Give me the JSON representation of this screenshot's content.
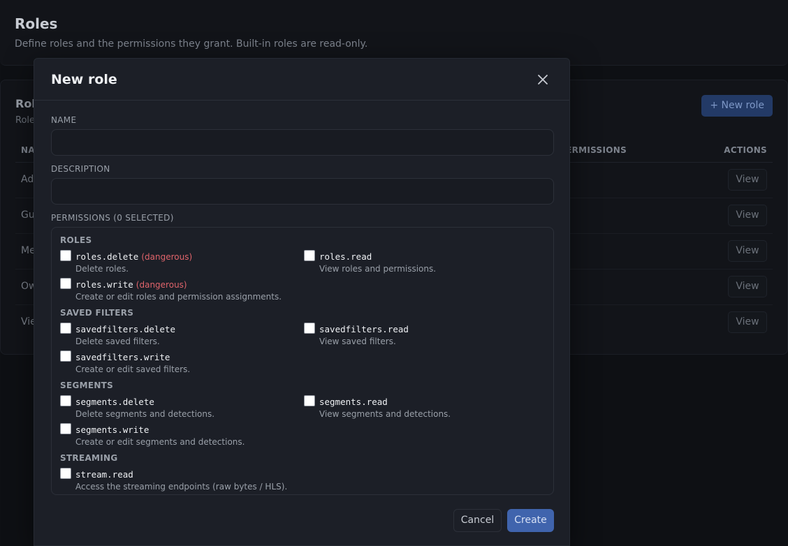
{
  "page": {
    "title": "Roles",
    "subtitle": "Define roles and the permissions they grant. Built-in roles are read-only."
  },
  "roles_card": {
    "title": "Roles",
    "subtitle": "Roles",
    "new_role_label": "+ New role",
    "columns": {
      "name": "NAME",
      "permissions": "PERMISSIONS",
      "actions": "ACTIONS"
    },
    "rows": [
      {
        "name": "Admin",
        "action": "View"
      },
      {
        "name": "Guest",
        "action": "View"
      },
      {
        "name": "Member",
        "action": "View"
      },
      {
        "name": "Owner",
        "action": "View"
      },
      {
        "name": "Viewer",
        "action": "View"
      }
    ]
  },
  "modal": {
    "title": "New role",
    "name_label": "NAME",
    "name_value": "",
    "description_label": "DESCRIPTION",
    "description_value": "",
    "permissions_label": "PERMISSIONS (0 SELECTED)",
    "groups": [
      {
        "title": "ROLES",
        "items": [
          {
            "key": "roles.delete",
            "danger": "(dangerous)",
            "desc": "Delete roles.",
            "checked": false
          },
          {
            "key": "roles.read",
            "danger": "",
            "desc": "View roles and permissions.",
            "checked": false
          },
          {
            "key": "roles.write",
            "danger": "(dangerous)",
            "desc": "Create or edit roles and permission assignments.",
            "checked": false
          }
        ]
      },
      {
        "title": "SAVED FILTERS",
        "items": [
          {
            "key": "savedfilters.delete",
            "danger": "",
            "desc": "Delete saved filters.",
            "checked": false
          },
          {
            "key": "savedfilters.read",
            "danger": "",
            "desc": "View saved filters.",
            "checked": false
          },
          {
            "key": "savedfilters.write",
            "danger": "",
            "desc": "Create or edit saved filters.",
            "checked": false
          }
        ]
      },
      {
        "title": "SEGMENTS",
        "items": [
          {
            "key": "segments.delete",
            "danger": "",
            "desc": "Delete segments and detections.",
            "checked": false
          },
          {
            "key": "segments.read",
            "danger": "",
            "desc": "View segments and detections.",
            "checked": false
          },
          {
            "key": "segments.write",
            "danger": "",
            "desc": "Create or edit segments and detections.",
            "checked": false
          }
        ]
      },
      {
        "title": "STREAMING",
        "items": [
          {
            "key": "stream.read",
            "danger": "",
            "desc": "Access the streaming endpoints (raw bytes / HLS).",
            "checked": false
          }
        ]
      }
    ],
    "cancel_label": "Cancel",
    "create_label": "Create"
  },
  "icons": {
    "close": "close-icon",
    "checkbox": "checkbox-icon"
  },
  "colors": {
    "primary": "#4064ad",
    "danger": "#e0646b",
    "modal_bg": "#1c1f27",
    "page_bg": "#0e1014"
  }
}
